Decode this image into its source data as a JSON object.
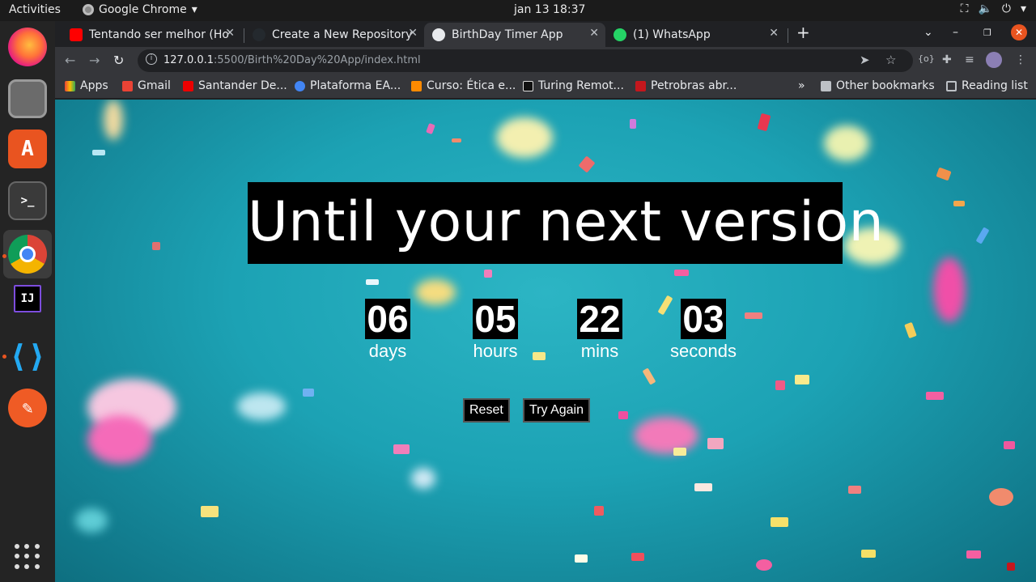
{
  "system": {
    "activities": "Activities",
    "app_name": "Google Chrome",
    "clock": "jan 13  18:37"
  },
  "tabs": [
    {
      "label": "Tentando ser melhor (Ho",
      "favicon_color": "#ff0000"
    },
    {
      "label": "Create a New Repository",
      "favicon_color": "#24292e"
    },
    {
      "label": "BirthDay Timer App",
      "favicon_color": "#9aa0a6"
    },
    {
      "label": "(1) WhatsApp",
      "favicon_color": "#25d366"
    }
  ],
  "omnibox": {
    "host": "127.0.0.1",
    "path": ":5500/Birth%20Day%20App/index.html"
  },
  "bookmarks": [
    {
      "label": "Apps",
      "color": "#e8453c"
    },
    {
      "label": "Gmail",
      "color": "#ea4335"
    },
    {
      "label": "Santander De...",
      "color": "#ec0000"
    },
    {
      "label": "Plataforma EA...",
      "color": "#4285f4"
    },
    {
      "label": "Curso: Ética e...",
      "color": "#ff8a00"
    },
    {
      "label": "Turing Remot...",
      "color": "#111111"
    },
    {
      "label": "Petrobras abr...",
      "color": "#c4171d"
    }
  ],
  "bookmarks_right": {
    "other": "Other bookmarks",
    "reading": "Reading list"
  },
  "page": {
    "headline": "Until your next version",
    "countdown": [
      {
        "value": "06",
        "label": "days"
      },
      {
        "value": "05",
        "label": "hours"
      },
      {
        "value": "22",
        "label": "mins"
      },
      {
        "value": "03",
        "label": "seconds"
      }
    ],
    "buttons": {
      "reset": "Reset",
      "try_again": "Try Again"
    }
  },
  "colors": {
    "page_bg": "#1ca2b4",
    "accent_close": "#e95420"
  }
}
